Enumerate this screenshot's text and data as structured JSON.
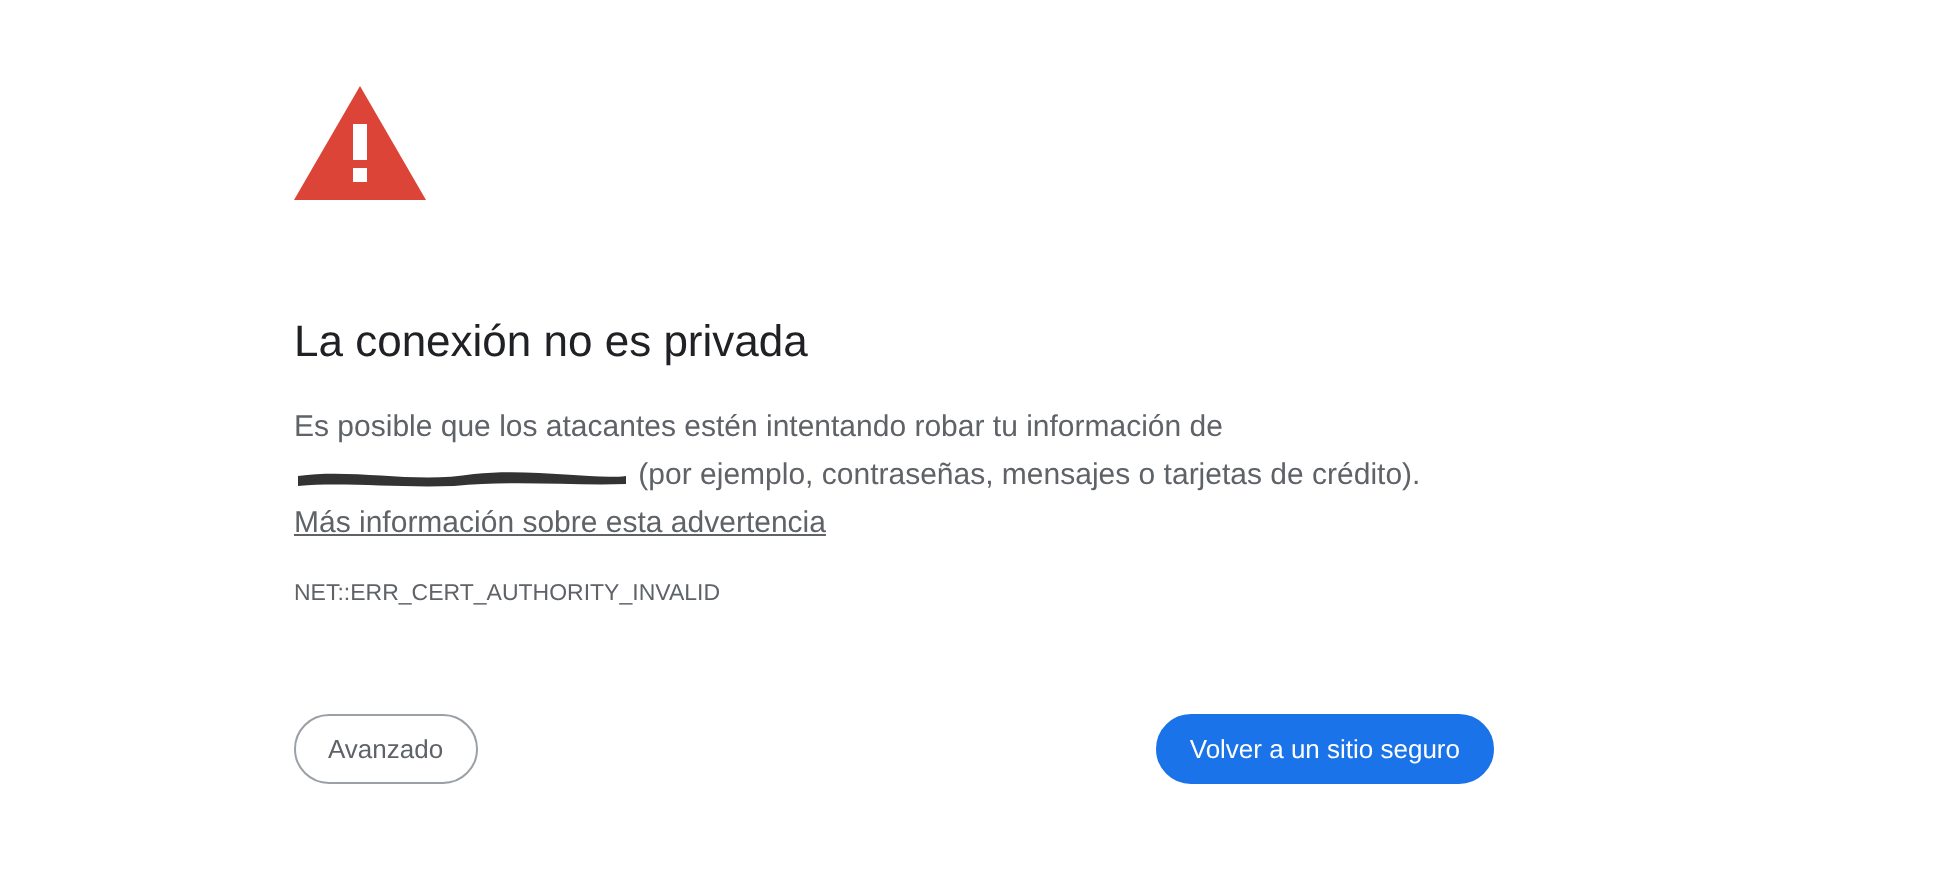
{
  "heading": "La conexión no es privada",
  "message": {
    "before": "Es posible que los atacantes estén intentando robar tu información de",
    "after": "(por ejemplo, contraseñas, mensajes o tarjetas de crédito).",
    "link": "Más información sobre esta advertencia"
  },
  "error_code": "NET::ERR_CERT_AUTHORITY_INVALID",
  "buttons": [
    {
      "label": "Avanzado",
      "kind": "secondary"
    },
    {
      "label": "Volver a un sitio seguro",
      "kind": "primary"
    }
  ]
}
